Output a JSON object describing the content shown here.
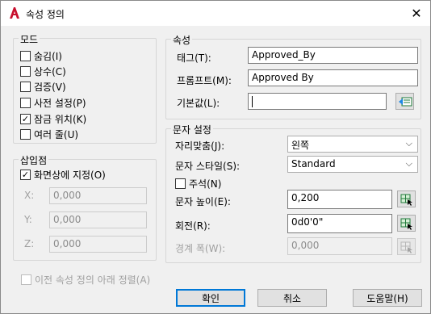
{
  "window": {
    "title": "속성 정의",
    "close_glyph": "✕"
  },
  "mode": {
    "legend": "모드",
    "options": [
      {
        "label": "숨김(I)",
        "checked": false
      },
      {
        "label": "상수(C)",
        "checked": false
      },
      {
        "label": "검증(V)",
        "checked": false
      },
      {
        "label": "사전 설정(P)",
        "checked": false
      },
      {
        "label": "잠금 위치(K)",
        "checked": true
      },
      {
        "label": "여러 줄(U)",
        "checked": false
      }
    ]
  },
  "insertion": {
    "legend": "삽입점",
    "specify_on_screen": {
      "label": "화면상에 지정(O)",
      "checked": true
    },
    "x": {
      "label": "X:",
      "value": "0,000"
    },
    "y": {
      "label": "Y:",
      "value": "0,000"
    },
    "z": {
      "label": "Z:",
      "value": "0,000"
    }
  },
  "attribute": {
    "legend": "속성",
    "tag": {
      "label": "태그(T):",
      "value": "Approved_By"
    },
    "prompt": {
      "label": "프롬프트(M):",
      "value": "Approved By"
    },
    "default": {
      "label": "기본값(L):",
      "value": ""
    }
  },
  "text_settings": {
    "legend": "문자 설정",
    "justification": {
      "label": "자리맞춤(J):",
      "value": "왼쪽"
    },
    "text_style": {
      "label": "문자 스타일(S):",
      "value": "Standard"
    },
    "annotative": {
      "label": "주석(N)",
      "checked": false
    },
    "text_height": {
      "label": "문자 높이(E):",
      "value": "0,200"
    },
    "rotation": {
      "label": "회전(R):",
      "value": "0d0'0\""
    },
    "boundary_width": {
      "label": "경계 폭(W):",
      "value": "0,000"
    }
  },
  "align_below": {
    "label": "이전 속성 정의 아래 정렬(A)",
    "checked": false
  },
  "buttons": {
    "ok": "확인",
    "cancel": "취소",
    "help": "도움말(H)"
  },
  "colors": {
    "accent": "#0078d7",
    "app_icon": "#c8102e"
  }
}
